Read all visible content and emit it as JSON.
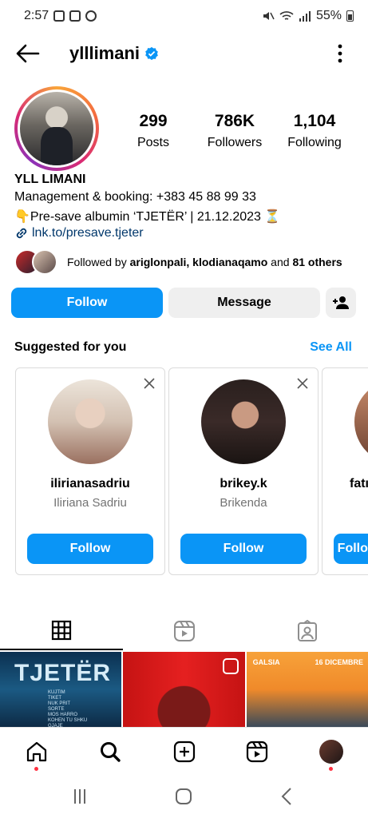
{
  "status_bar": {
    "time": "2:57",
    "battery": "55%"
  },
  "header": {
    "username": "ylllimani"
  },
  "profile": {
    "stats": [
      {
        "value": "299",
        "label": "Posts"
      },
      {
        "value": "786K",
        "label": "Followers"
      },
      {
        "value": "1,104",
        "label": "Following"
      }
    ],
    "display_name": "YLL LIMANI",
    "bio_line1": "Management & booking: +383 45 88 99 33",
    "bio_line2_prefix": "👇",
    "bio_line2": "Pre-save albumin ‘TJETËR’ | 21.12.2023 ",
    "bio_line2_suffix": "⏳",
    "link": "lnk.to/presave.tjeter",
    "followed_by_prefix": "Followed by ",
    "followed_by_users": "ariglonpali, klodianaqamo",
    "followed_by_and": " and ",
    "followed_by_others": "81 others"
  },
  "actions": {
    "follow": "Follow",
    "message": "Message"
  },
  "suggested": {
    "title": "Suggested for you",
    "see_all": "See All",
    "cards": [
      {
        "username": "ilirianasadriu",
        "name": "Iliriana Sadriu",
        "button": "Follow"
      },
      {
        "username": "brikey.k",
        "name": "Brikenda",
        "button": "Follow"
      },
      {
        "username": "fatı",
        "name": "",
        "button": "Follow"
      }
    ]
  },
  "grid": {
    "post1_title": "TJETËR",
    "post1_tracks": "KUJTIM\nTIKET\nNUK PRIT\nSORTE\nMOS HARRO\nKOHEN TU SHKU\nGJAJE",
    "post3_brand": "GALSIA",
    "post3_date": "16 DICEMBRE"
  },
  "colors": {
    "accent": "#0a95f6",
    "button_gray": "#efefef",
    "notification": "#ff3040"
  }
}
